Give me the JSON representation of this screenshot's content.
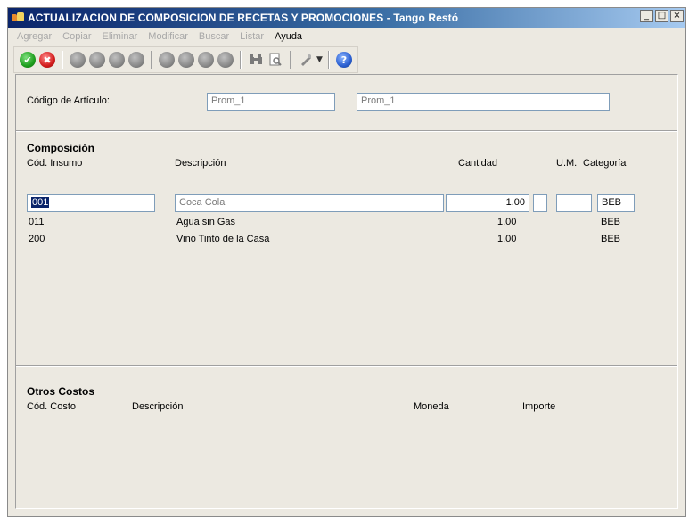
{
  "window": {
    "title": "ACTUALIZACION DE COMPOSICION DE RECETAS Y PROMOCIONES - Tango Restó",
    "minimize": "_",
    "maximize": "□",
    "close": "×"
  },
  "menu": {
    "items": [
      {
        "label": "Agregar",
        "enabled": false
      },
      {
        "label": "Copiar",
        "enabled": false
      },
      {
        "label": "Eliminar",
        "enabled": false
      },
      {
        "label": "Modificar",
        "enabled": false
      },
      {
        "label": "Buscar",
        "enabled": false
      },
      {
        "label": "Listar",
        "enabled": false
      },
      {
        "label": "Ayuda",
        "enabled": true
      }
    ]
  },
  "toolbar": {
    "icons": [
      "accept-icon",
      "cancel-icon",
      "first-icon",
      "previous-icon",
      "next-icon",
      "last-icon",
      "record-1-icon",
      "record-2-icon",
      "record-3-icon",
      "record-4-icon",
      "binoculars-icon",
      "print-preview-icon",
      "tools-icon",
      "help-icon"
    ],
    "accept_glyph": "✔",
    "cancel_glyph": "✖",
    "help_glyph": "?"
  },
  "header": {
    "codigo_label": "Código de Artículo:",
    "codigo_value": "Prom_1",
    "descripcion_value": "Prom_1"
  },
  "composicion": {
    "title": "Composición",
    "columns": {
      "cod_insumo": "Cód. Insumo",
      "descripcion": "Descripción",
      "cantidad": "Cantidad",
      "um": "U.M.",
      "categoria": "Categoría"
    },
    "edit_row": {
      "cod": "001",
      "descripcion": "Coca Cola",
      "cantidad": "1.00",
      "um": "",
      "categoria": "BEB"
    },
    "rows": [
      {
        "cod": "011",
        "descripcion": "Agua sin Gas",
        "cantidad": "1.00",
        "categoria": "BEB"
      },
      {
        "cod": "200",
        "descripcion": "Vino Tinto de la Casa",
        "cantidad": "1.00",
        "categoria": "BEB"
      }
    ]
  },
  "otros_costos": {
    "title": "Otros Costos",
    "columns": {
      "cod_costo": "Cód. Costo",
      "descripcion": "Descripción",
      "moneda": "Moneda",
      "importe": "Importe"
    }
  }
}
